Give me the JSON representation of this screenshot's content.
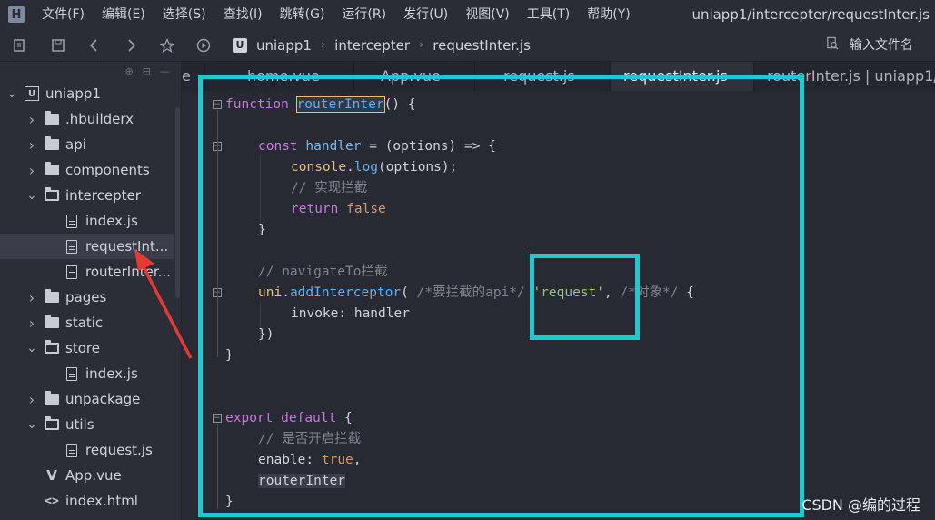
{
  "menubar": {
    "items": [
      "文件(F)",
      "编辑(E)",
      "选择(S)",
      "查找(I)",
      "跳转(G)",
      "运行(R)",
      "发行(U)",
      "视图(V)",
      "工具(T)",
      "帮助(Y)"
    ],
    "window_title": "uniapp1/intercepter/requestInter.js"
  },
  "toolbar": {
    "breadcrumb": [
      "uniapp1",
      "intercepter",
      "requestInter.js"
    ],
    "search_placeholder": "输入文件名"
  },
  "sidebar": {
    "items": [
      {
        "label": "uniapp1",
        "type": "project",
        "open": true
      },
      {
        "label": ".hbuilderx",
        "type": "folder",
        "open": false
      },
      {
        "label": "api",
        "type": "folder",
        "open": false
      },
      {
        "label": "components",
        "type": "folder",
        "open": false
      },
      {
        "label": "intercepter",
        "type": "folder",
        "open": true
      },
      {
        "label": "index.js",
        "type": "file"
      },
      {
        "label": "requestInt...",
        "type": "file",
        "selected": true
      },
      {
        "label": "routerInter...",
        "type": "file"
      },
      {
        "label": "pages",
        "type": "folder",
        "open": false
      },
      {
        "label": "static",
        "type": "folder",
        "open": false
      },
      {
        "label": "store",
        "type": "folder",
        "open": true
      },
      {
        "label": "index.js",
        "type": "file"
      },
      {
        "label": "unpackage",
        "type": "folder",
        "open": false
      },
      {
        "label": "utils",
        "type": "folder",
        "open": true
      },
      {
        "label": "request.js",
        "type": "file"
      },
      {
        "label": "App.vue",
        "type": "vue"
      },
      {
        "label": "index.html",
        "type": "html"
      }
    ]
  },
  "tabs": [
    {
      "label": "e",
      "active": false
    },
    {
      "label": "home.vue",
      "active": false
    },
    {
      "label": "App.vue",
      "active": false
    },
    {
      "label": "request.js",
      "active": false
    },
    {
      "label": "requestInter.js",
      "active": true
    },
    {
      "label": "routerInter.js | uniapp1/",
      "active": false
    }
  ],
  "code": {
    "l1_kw": "function",
    "l1_name": "routerInter",
    "l1_rest": "() {",
    "l3_kw": "const",
    "l3_var": "handler",
    "l3_rest": " = (options) => {",
    "l4_obj": "console",
    "l4_dot": ".",
    "l4_fn": "log",
    "l4_rest": "(options);",
    "l5_cm": "// 实现拦截",
    "l6_kw": "return",
    "l6_val": "false",
    "l7": "}",
    "l9_cm": "// navigateTo拦截",
    "l10_obj": "uni",
    "l10_dot": ".",
    "l10_fn": "addInterceptor",
    "l10_p1": "( ",
    "l10_cm1": "/*要拦截的api*/",
    "l10_str": "'request'",
    "l10_p2": ", ",
    "l10_cm2": "/*对象*/",
    "l10_p3": " {",
    "l11_prop": "invoke",
    "l11_rest": ": handler",
    "l12": "})",
    "l13": "}",
    "l16_kw1": "export",
    "l16_kw2": "default",
    "l16_rest": " {",
    "l17_cm": "// 是否开启拦截",
    "l18_prop": "enable",
    "l18_p": ": ",
    "l18_val": "true",
    "l18_end": ",",
    "l19": "routerInter",
    "l20": "}"
  },
  "watermark": "CSDN @编的过程",
  "colors": {
    "annotation_cyan": "#1ec9cf",
    "annotation_arrow": "#e53935"
  }
}
